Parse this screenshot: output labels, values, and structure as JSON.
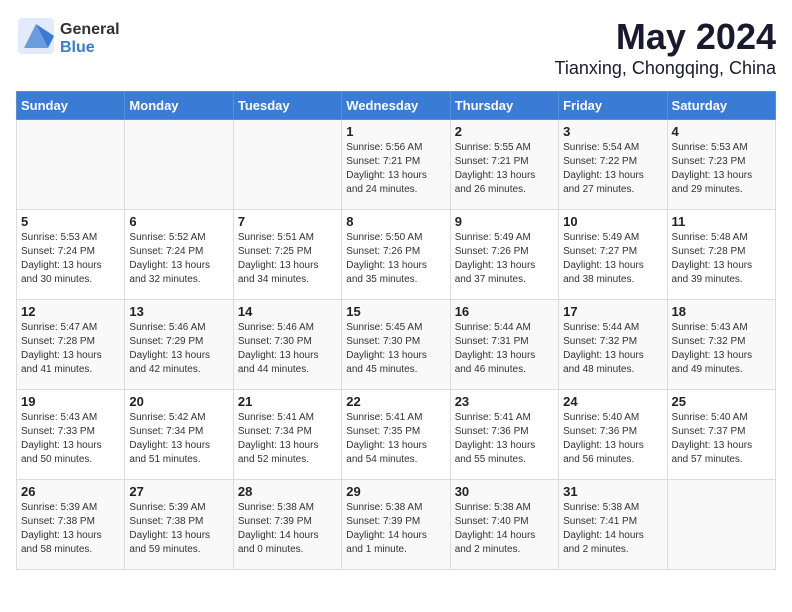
{
  "header": {
    "logo_general": "General",
    "logo_blue": "Blue",
    "title": "May 2024",
    "subtitle": "Tianxing, Chongqing, China"
  },
  "weekdays": [
    "Sunday",
    "Monday",
    "Tuesday",
    "Wednesday",
    "Thursday",
    "Friday",
    "Saturday"
  ],
  "weeks": [
    [
      {
        "day": "",
        "info": ""
      },
      {
        "day": "",
        "info": ""
      },
      {
        "day": "",
        "info": ""
      },
      {
        "day": "1",
        "info": "Sunrise: 5:56 AM\nSunset: 7:21 PM\nDaylight: 13 hours\nand 24 minutes."
      },
      {
        "day": "2",
        "info": "Sunrise: 5:55 AM\nSunset: 7:21 PM\nDaylight: 13 hours\nand 26 minutes."
      },
      {
        "day": "3",
        "info": "Sunrise: 5:54 AM\nSunset: 7:22 PM\nDaylight: 13 hours\nand 27 minutes."
      },
      {
        "day": "4",
        "info": "Sunrise: 5:53 AM\nSunset: 7:23 PM\nDaylight: 13 hours\nand 29 minutes."
      }
    ],
    [
      {
        "day": "5",
        "info": "Sunrise: 5:53 AM\nSunset: 7:24 PM\nDaylight: 13 hours\nand 30 minutes."
      },
      {
        "day": "6",
        "info": "Sunrise: 5:52 AM\nSunset: 7:24 PM\nDaylight: 13 hours\nand 32 minutes."
      },
      {
        "day": "7",
        "info": "Sunrise: 5:51 AM\nSunset: 7:25 PM\nDaylight: 13 hours\nand 34 minutes."
      },
      {
        "day": "8",
        "info": "Sunrise: 5:50 AM\nSunset: 7:26 PM\nDaylight: 13 hours\nand 35 minutes."
      },
      {
        "day": "9",
        "info": "Sunrise: 5:49 AM\nSunset: 7:26 PM\nDaylight: 13 hours\nand 37 minutes."
      },
      {
        "day": "10",
        "info": "Sunrise: 5:49 AM\nSunset: 7:27 PM\nDaylight: 13 hours\nand 38 minutes."
      },
      {
        "day": "11",
        "info": "Sunrise: 5:48 AM\nSunset: 7:28 PM\nDaylight: 13 hours\nand 39 minutes."
      }
    ],
    [
      {
        "day": "12",
        "info": "Sunrise: 5:47 AM\nSunset: 7:28 PM\nDaylight: 13 hours\nand 41 minutes."
      },
      {
        "day": "13",
        "info": "Sunrise: 5:46 AM\nSunset: 7:29 PM\nDaylight: 13 hours\nand 42 minutes."
      },
      {
        "day": "14",
        "info": "Sunrise: 5:46 AM\nSunset: 7:30 PM\nDaylight: 13 hours\nand 44 minutes."
      },
      {
        "day": "15",
        "info": "Sunrise: 5:45 AM\nSunset: 7:30 PM\nDaylight: 13 hours\nand 45 minutes."
      },
      {
        "day": "16",
        "info": "Sunrise: 5:44 AM\nSunset: 7:31 PM\nDaylight: 13 hours\nand 46 minutes."
      },
      {
        "day": "17",
        "info": "Sunrise: 5:44 AM\nSunset: 7:32 PM\nDaylight: 13 hours\nand 48 minutes."
      },
      {
        "day": "18",
        "info": "Sunrise: 5:43 AM\nSunset: 7:32 PM\nDaylight: 13 hours\nand 49 minutes."
      }
    ],
    [
      {
        "day": "19",
        "info": "Sunrise: 5:43 AM\nSunset: 7:33 PM\nDaylight: 13 hours\nand 50 minutes."
      },
      {
        "day": "20",
        "info": "Sunrise: 5:42 AM\nSunset: 7:34 PM\nDaylight: 13 hours\nand 51 minutes."
      },
      {
        "day": "21",
        "info": "Sunrise: 5:41 AM\nSunset: 7:34 PM\nDaylight: 13 hours\nand 52 minutes."
      },
      {
        "day": "22",
        "info": "Sunrise: 5:41 AM\nSunset: 7:35 PM\nDaylight: 13 hours\nand 54 minutes."
      },
      {
        "day": "23",
        "info": "Sunrise: 5:41 AM\nSunset: 7:36 PM\nDaylight: 13 hours\nand 55 minutes."
      },
      {
        "day": "24",
        "info": "Sunrise: 5:40 AM\nSunset: 7:36 PM\nDaylight: 13 hours\nand 56 minutes."
      },
      {
        "day": "25",
        "info": "Sunrise: 5:40 AM\nSunset: 7:37 PM\nDaylight: 13 hours\nand 57 minutes."
      }
    ],
    [
      {
        "day": "26",
        "info": "Sunrise: 5:39 AM\nSunset: 7:38 PM\nDaylight: 13 hours\nand 58 minutes."
      },
      {
        "day": "27",
        "info": "Sunrise: 5:39 AM\nSunset: 7:38 PM\nDaylight: 13 hours\nand 59 minutes."
      },
      {
        "day": "28",
        "info": "Sunrise: 5:38 AM\nSunset: 7:39 PM\nDaylight: 14 hours\nand 0 minutes."
      },
      {
        "day": "29",
        "info": "Sunrise: 5:38 AM\nSunset: 7:39 PM\nDaylight: 14 hours\nand 1 minute."
      },
      {
        "day": "30",
        "info": "Sunrise: 5:38 AM\nSunset: 7:40 PM\nDaylight: 14 hours\nand 2 minutes."
      },
      {
        "day": "31",
        "info": "Sunrise: 5:38 AM\nSunset: 7:41 PM\nDaylight: 14 hours\nand 2 minutes."
      },
      {
        "day": "",
        "info": ""
      }
    ]
  ]
}
